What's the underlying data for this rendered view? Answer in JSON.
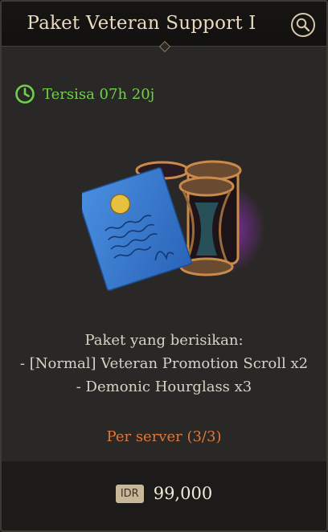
{
  "header": {
    "title": "Paket Veteran Support I",
    "search_icon": "search-icon"
  },
  "timer": {
    "icon": "clock-icon",
    "label": "Tersisa 07h 20j",
    "color": "#6fd14a"
  },
  "item_art": {
    "icon": "scroll-and-hourglass-icon"
  },
  "contents": {
    "heading": "Paket yang berisikan:",
    "items": [
      "- [Normal] Veteran Promotion Scroll x2",
      "- Demonic Hourglass x3"
    ]
  },
  "limit": {
    "label": "Per server (3/3)",
    "color": "#e0763a"
  },
  "purchase": {
    "currency": "IDR",
    "price": "99,000"
  }
}
